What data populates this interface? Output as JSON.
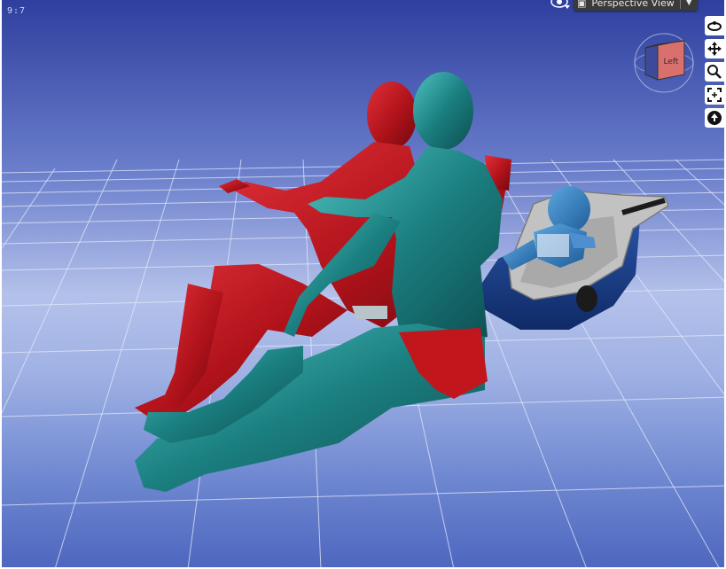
{
  "viewport": {
    "frame_counter": "9:7",
    "view_selector": {
      "label": "Perspective View",
      "dropdown_glyph": "▼"
    },
    "nav_cube": {
      "face_label": "Left",
      "face_color": "#d9706e"
    },
    "nav_tools": [
      {
        "name": "orbit-icon"
      },
      {
        "name": "pan-icon"
      },
      {
        "name": "zoom-icon"
      },
      {
        "name": "frame-icon"
      },
      {
        "name": "reset-view-icon"
      }
    ],
    "colors": {
      "red_figure": "#b0121a",
      "teal_figure": "#1b7f80",
      "baby_figure": "#2a6fb0",
      "car_seat_shell": "#1a3d86",
      "car_seat_liner": "#bdbdbd",
      "grid_line": "#dfe6fb"
    }
  }
}
